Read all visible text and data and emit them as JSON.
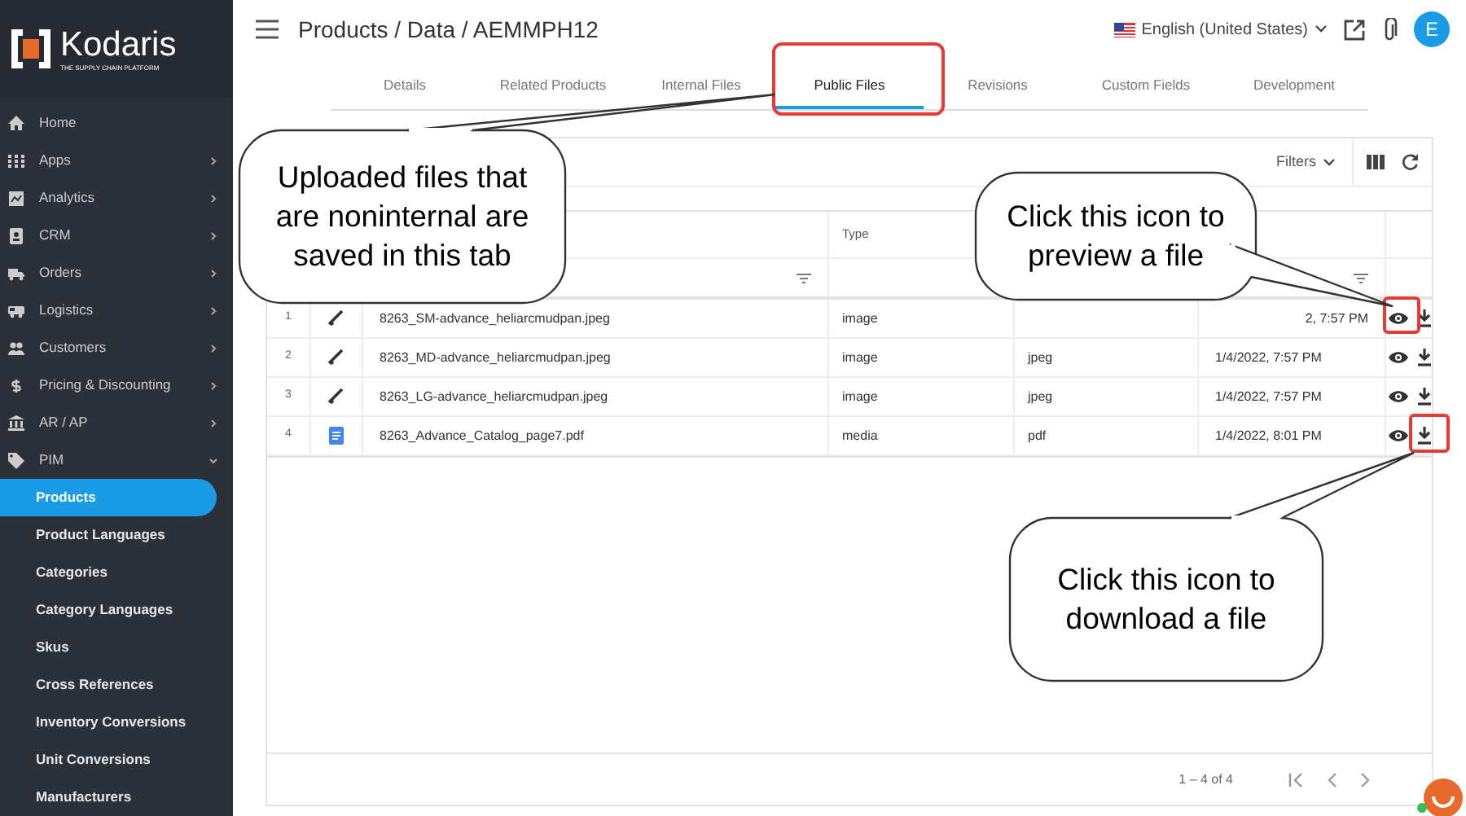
{
  "sidebar": {
    "logo": {
      "name": "Kodaris",
      "tagline": "THE SUPPLY CHAIN PLATFORM"
    },
    "items": [
      {
        "label": "Home"
      },
      {
        "label": "Apps",
        "expanded": false
      },
      {
        "label": "Analytics",
        "expanded": false
      },
      {
        "label": "CRM",
        "expanded": false
      },
      {
        "label": "Orders",
        "expanded": false
      },
      {
        "label": "Logistics",
        "expanded": false
      },
      {
        "label": "Customers",
        "expanded": false
      },
      {
        "label": "Pricing & Discounting",
        "expanded": false
      },
      {
        "label": "AR / AP",
        "expanded": false
      },
      {
        "label": "PIM",
        "expanded": true,
        "children": [
          {
            "label": "Products",
            "selected": true
          },
          {
            "label": "Product Languages",
            "selected": false
          },
          {
            "label": "Categories",
            "selected": false
          },
          {
            "label": "Category Languages",
            "selected": false
          },
          {
            "label": "Skus",
            "selected": false
          },
          {
            "label": "Cross References",
            "selected": false
          },
          {
            "label": "Inventory Conversions",
            "selected": false
          },
          {
            "label": "Unit Conversions",
            "selected": false
          },
          {
            "label": "Manufacturers",
            "selected": false
          }
        ]
      }
    ]
  },
  "header": {
    "breadcrumb": "Products / Data / AEMMPH12",
    "language": "English (United States)",
    "avatar": "E"
  },
  "tabs": [
    {
      "label": "Details",
      "selected": false
    },
    {
      "label": "Related Products",
      "selected": false
    },
    {
      "label": "Internal Files",
      "selected": false
    },
    {
      "label": "Public Files",
      "selected": true
    },
    {
      "label": "Revisions",
      "selected": false
    },
    {
      "label": "Custom Fields",
      "selected": false
    },
    {
      "label": "Development",
      "selected": false
    }
  ],
  "toolbar": {
    "filters": "Filters"
  },
  "table": {
    "columns": [
      {
        "label": "Type"
      }
    ],
    "rows": [
      {
        "index": "1",
        "kind": "image",
        "name": "8263_SM-advance_heliarcmudpan.jpeg",
        "type": "image",
        "date": "2, 7:57 PM"
      },
      {
        "index": "2",
        "kind": "image",
        "name": "8263_MD-advance_heliarcmudpan.jpeg",
        "type": "image",
        "extension": "jpeg",
        "date": "1/4/2022, 7:57 PM"
      },
      {
        "index": "3",
        "kind": "image",
        "name": "8263_LG-advance_heliarcmudpan.jpeg",
        "type": "image",
        "extension": "jpeg",
        "date": "1/4/2022, 7:57 PM"
      },
      {
        "index": "4",
        "kind": "document",
        "name": "8263_Advance_Catalog_page7.pdf",
        "type": "media",
        "extension": "pdf",
        "date": "1/4/2022, 8:01 PM"
      }
    ]
  },
  "pagination": {
    "range": "1 – 4 of 4"
  },
  "callouts": [
    {
      "text": "Uploaded files that are noninternal are saved in this tab"
    },
    {
      "text": "Click this icon to preview a file"
    },
    {
      "text": "Click this icon to download a file"
    }
  ]
}
